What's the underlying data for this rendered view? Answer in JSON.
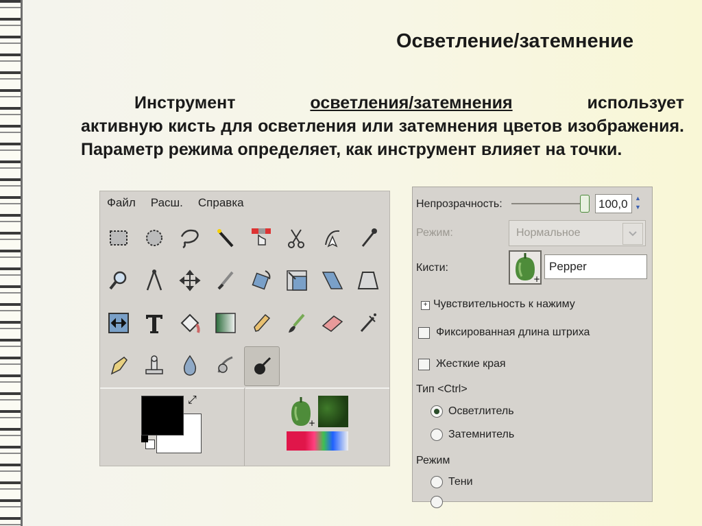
{
  "slide": {
    "title": "Осветление/затемнение",
    "para_line1_a": "Инструмент",
    "para_line1_link": "осветления/затемнения",
    "para_line1_b": "использует",
    "para_rest": "активную кисть для осветления или затемнения цветов изображения. Параметр режима определяет, как инструмент влияет на точки."
  },
  "toolbox": {
    "menu": [
      {
        "label": "Файл"
      },
      {
        "label": "Расш."
      },
      {
        "label": "Справка"
      }
    ],
    "tools": [
      "rect-select-icon",
      "ellipse-select-icon",
      "free-select-icon",
      "fuzzy-select-icon",
      "color-select-icon",
      "scissors-icon",
      "paths-icon",
      "color-picker-icon",
      "magnify-icon",
      "measure-icon",
      "move-icon",
      "crop-icon",
      "rotate-icon",
      "scale-icon",
      "shear-icon",
      "perspective-icon",
      "flip-icon",
      "text-icon",
      "bucket-fill-icon",
      "blend-icon",
      "pencil-icon",
      "paintbrush-icon",
      "eraser-icon",
      "airbrush-icon",
      "ink-icon",
      "clone-icon",
      "blur-icon",
      "smudge-icon",
      "dodge-burn-icon"
    ],
    "active_tool": "dodge-burn-icon",
    "fg_color": "#000000",
    "bg_color": "#ffffff"
  },
  "options": {
    "opacity_label": "Непрозрачность:",
    "opacity_value": "100,0",
    "mode_label": "Режим:",
    "mode_value": "Нормальное",
    "brushes_label": "Кисти:",
    "brush_name": "Pepper",
    "pressure_label": "Чувствительность к нажиму",
    "fixed_length_label": "Фиксированная длина штриха",
    "hard_edges_label": "Жесткие края",
    "type_label": "Тип  <Ctrl>",
    "type_dodge": "Осветлитель",
    "type_burn": "Затемнитель",
    "range_label": "Режим",
    "range_shadows": "Тени"
  }
}
